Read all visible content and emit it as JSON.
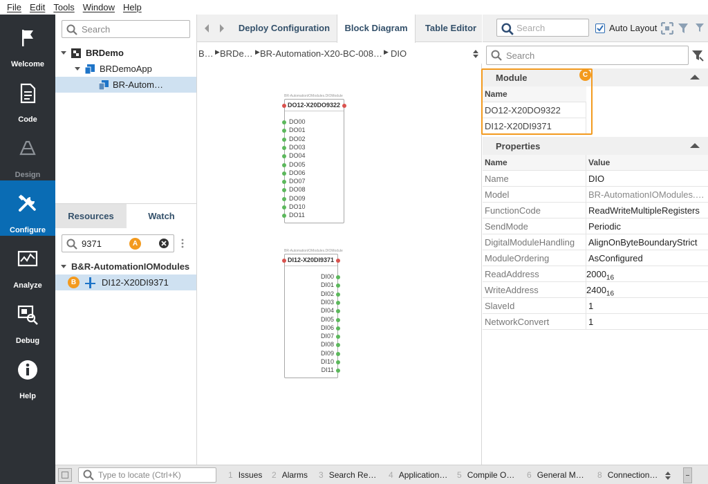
{
  "menu": [
    "File",
    "Edit",
    "Tools",
    "Window",
    "Help"
  ],
  "nav": [
    {
      "label": "Welcome",
      "icon": "flag-icon",
      "state": "normal"
    },
    {
      "label": "Code",
      "icon": "document-icon",
      "state": "normal"
    },
    {
      "label": "Design",
      "icon": "design-icon",
      "state": "dim"
    },
    {
      "label": "Configure",
      "icon": "tools-icon",
      "state": "active"
    },
    {
      "label": "Analyze",
      "icon": "chart-icon",
      "state": "normal"
    },
    {
      "label": "Debug",
      "icon": "debug-icon",
      "state": "normal"
    },
    {
      "label": "Help",
      "icon": "info-icon",
      "state": "normal"
    }
  ],
  "project": {
    "search_placeholder": "Search",
    "root": "BRDemo",
    "app": "BRDemoApp",
    "item": "BR-Autom…"
  },
  "resources": {
    "tabs": [
      "Resources",
      "Watch"
    ],
    "filter_value": "9371",
    "group": "B&R-AutomationIOModules",
    "result": "DI12-X20DI9371",
    "badge_a": "A",
    "badge_b": "B"
  },
  "editor": {
    "tabs": [
      "Deploy Configuration",
      "Block Diagram",
      "Table Editor"
    ],
    "active_tab": "Block Diagram",
    "breadcrumb": [
      "B…",
      "BRDe…",
      "BR-Automation-X20-BC-008…",
      "DIO"
    ],
    "block1": {
      "header": "BR-AutomationIOModules.DIOModule",
      "title": "DO12-X20DO9322",
      "pins": [
        "DO00",
        "DO01",
        "DO02",
        "DO03",
        "DO04",
        "DO05",
        "DO06",
        "DO07",
        "DO08",
        "DO09",
        "DO10",
        "DO11"
      ]
    },
    "block2": {
      "header": "BR-AutomationIOModules.DIOModule",
      "title": "DI12-X20DI9371",
      "pins": [
        "DI00",
        "DI01",
        "DI02",
        "DI03",
        "DI04",
        "DI05",
        "DI06",
        "DI07",
        "DI08",
        "DI09",
        "DI10",
        "DI11"
      ]
    }
  },
  "toolbar": {
    "search_placeholder": "Search",
    "auto_layout": "Auto Layout",
    "auto_layout_checked": true
  },
  "properties_panel": {
    "search_placeholder": "Search",
    "module_section": "Module",
    "module_header": "Name",
    "modules": [
      "DO12-X20DO9322",
      "DI12-X20DI9371"
    ],
    "badge_c": "C",
    "properties_section": "Properties",
    "col_name": "Name",
    "col_value": "Value",
    "rows": [
      {
        "name": "Name",
        "value": "DIO"
      },
      {
        "name": "Model",
        "value": "BR-AutomationIOModules.…"
      },
      {
        "name": "FunctionCode",
        "value": "ReadWriteMultipleRegisters"
      },
      {
        "name": "SendMode",
        "value": "Periodic"
      },
      {
        "name": "DigitalModuleHandling",
        "value": "AlignOnByteBoundaryStrict"
      },
      {
        "name": "ModuleOrdering",
        "value": "AsConfigured"
      },
      {
        "name": "ReadAddress",
        "value": "2000",
        "sub": "16"
      },
      {
        "name": "WriteAddress",
        "value": "2400",
        "sub": "16"
      },
      {
        "name": "SlaveId",
        "value": "1"
      },
      {
        "name": "NetworkConvert",
        "value": "1"
      }
    ]
  },
  "statusbar": {
    "locate_placeholder": "Type to locate (Ctrl+K)",
    "tabs": [
      {
        "n": "1",
        "label": "Issues"
      },
      {
        "n": "2",
        "label": "Alarms"
      },
      {
        "n": "3",
        "label": "Search Re…"
      },
      {
        "n": "4",
        "label": "Application…"
      },
      {
        "n": "5",
        "label": "Compile O…"
      },
      {
        "n": "6",
        "label": "General M…"
      },
      {
        "n": "8",
        "label": "Connection…"
      }
    ]
  }
}
